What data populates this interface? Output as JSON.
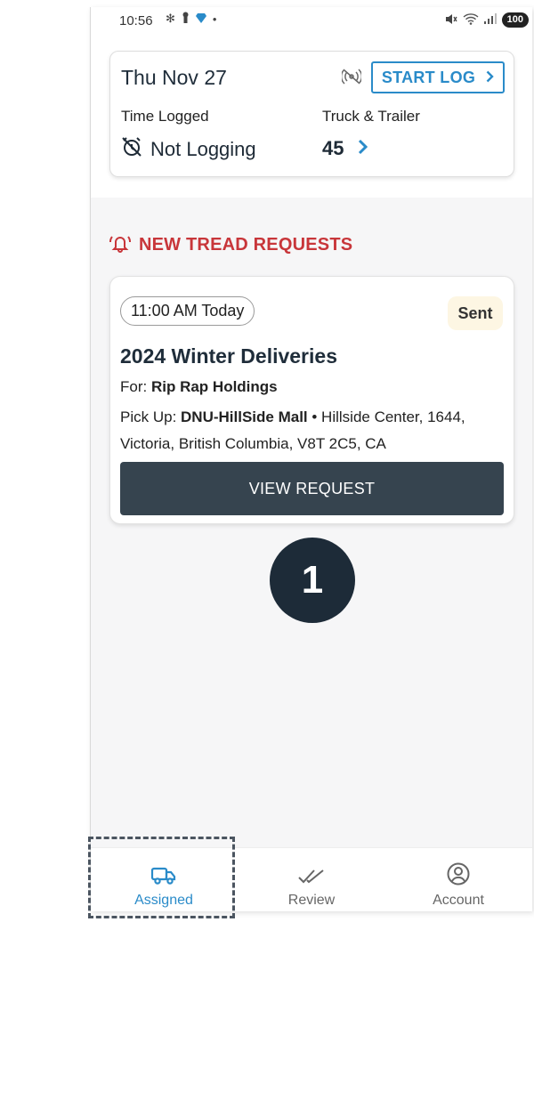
{
  "status_bar": {
    "time": "10:56",
    "battery": "100"
  },
  "log_card": {
    "date": "Thu Nov 27",
    "start_log_label": "START LOG",
    "time_logged_label": "Time Logged",
    "truck_trailer_label": "Truck & Trailer",
    "not_logging_text": "Not Logging",
    "truck_value": "45"
  },
  "section": {
    "title": "NEW TREAD REQUESTS"
  },
  "request": {
    "time_chip": "11:00 AM Today",
    "status": "Sent",
    "title": "2024 Winter Deliveries",
    "for_label": "For:",
    "for_value": "Rip Rap Holdings",
    "pickup_label": "Pick Up:",
    "pickup_name": "DNU-HillSide Mall",
    "pickup_address": " • Hillside Center, 1644, Victoria, British Columbia, V8T 2C5, CA",
    "view_button": "VIEW REQUEST"
  },
  "nav": {
    "assigned": "Assigned",
    "review": "Review",
    "account": "Account"
  },
  "tutorial": {
    "step_number": "1"
  },
  "colors": {
    "accent": "#2a8bc9",
    "alert": "#c8363a",
    "button_dark": "#36444f"
  }
}
